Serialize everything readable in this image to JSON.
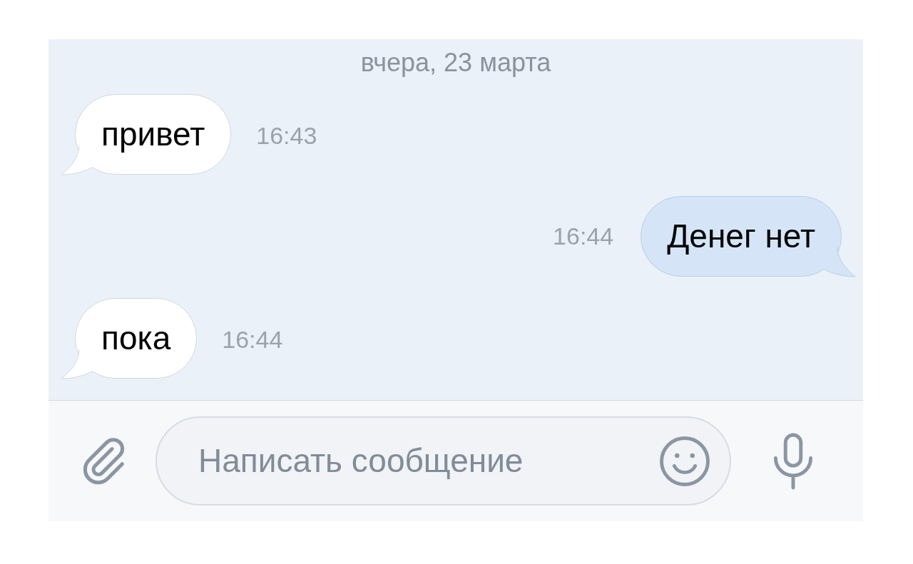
{
  "date_divider": "вчера, 23 марта",
  "messages": [
    {
      "text": "привет",
      "time": "16:43",
      "outgoing": false
    },
    {
      "text": "Денег нет",
      "time": "16:44",
      "outgoing": true
    },
    {
      "text": "пока",
      "time": "16:44",
      "outgoing": false
    }
  ],
  "composer": {
    "placeholder": "Написать сообщение"
  }
}
